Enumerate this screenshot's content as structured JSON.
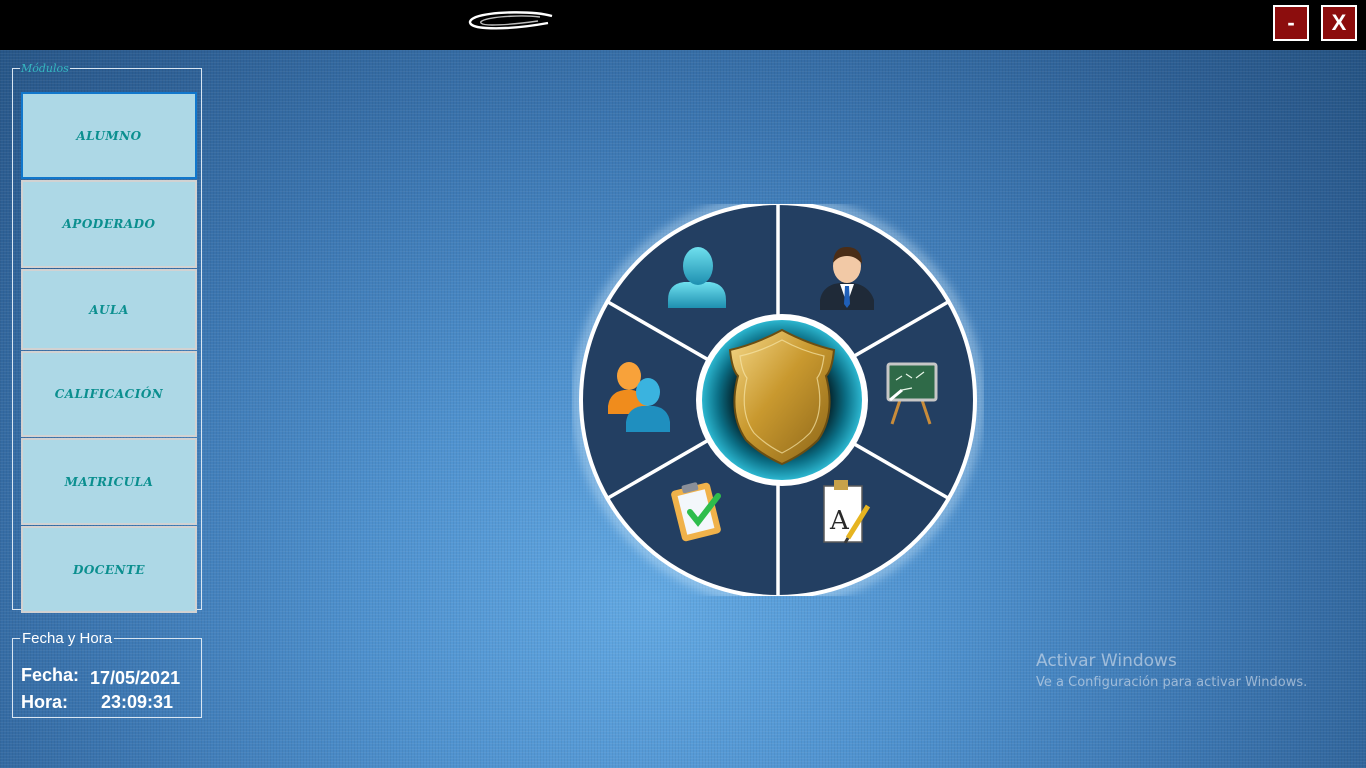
{
  "window": {
    "logo_icon": "swoosh-logo-icon",
    "minimize_label": "-",
    "close_label": "X",
    "button_color": "#8c0d0d"
  },
  "modules": {
    "legend": "Módulos",
    "items": [
      {
        "label": "ALUMNO",
        "active": true
      },
      {
        "label": "APODERADO",
        "active": false
      },
      {
        "label": "AULA",
        "active": false
      },
      {
        "label": "CALIFICACIÓN",
        "active": false
      },
      {
        "label": "MATRICULA",
        "active": false
      },
      {
        "label": "DOCENTE",
        "active": false
      }
    ]
  },
  "datetime": {
    "legend": "Fecha y Hora",
    "fecha_label": "Fecha:",
    "fecha_value": "17/05/2021",
    "hora_label": "Hora:",
    "hora_value": "23:09:31"
  },
  "wheel": {
    "center_icon": "gold-shield-icon",
    "segments": [
      {
        "icon": "student-silhouette-icon"
      },
      {
        "icon": "businessman-icon"
      },
      {
        "icon": "chalkboard-icon"
      },
      {
        "icon": "document-pencil-icon"
      },
      {
        "icon": "clipboard-check-icon"
      },
      {
        "icon": "users-group-icon"
      }
    ]
  },
  "watermark": {
    "title": "Activar Windows",
    "subtitle": "Ve a Configuración para activar Windows."
  }
}
